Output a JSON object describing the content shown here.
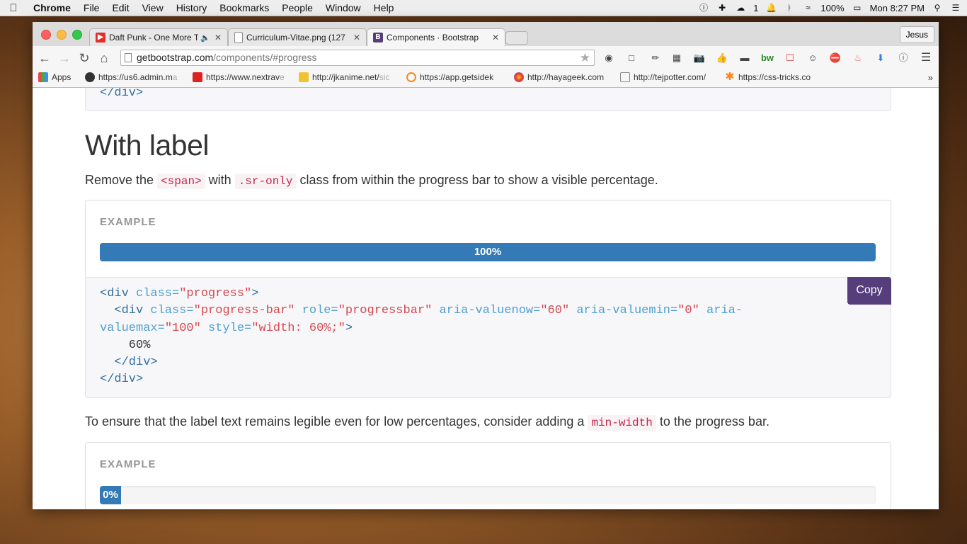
{
  "menubar": {
    "app": "Chrome",
    "items": [
      "File",
      "Edit",
      "View",
      "History",
      "Bookmarks",
      "People",
      "Window",
      "Help"
    ],
    "wifi_count": "1",
    "battery": "100%",
    "clock": "Mon 8:27 PM"
  },
  "tabs": [
    {
      "title": "Daft Punk - One More T",
      "favicon": "youtube-icon",
      "color": "#e52d27"
    },
    {
      "title": "Curriculum-Vitae.png (127",
      "favicon": "file-icon",
      "color": "#ffffff"
    },
    {
      "title": "Components · Bootstrap",
      "favicon": "bootstrap-icon",
      "color": "#563d7c"
    }
  ],
  "profile": "Jesus",
  "url": {
    "host": "getbootstrap.com",
    "path": "/components/#progress"
  },
  "bookmarks": {
    "apps_label": "Apps",
    "items": [
      {
        "label": "https://us6.admin.m",
        "fade": "a"
      },
      {
        "label": "https://www.nextrav",
        "fade": "e"
      },
      {
        "label": "http://jkanime.net/",
        "fade": "sic"
      },
      {
        "label": "https://app.getsidek",
        "fade": ""
      },
      {
        "label": "http://hayageek.com",
        "fade": ""
      },
      {
        "label": "http://tejpotter.com/",
        "fade": ""
      },
      {
        "label": "https://css-tricks.co",
        "fade": ""
      }
    ],
    "more": "»"
  },
  "content": {
    "top_code_line": "</div>",
    "heading": "With label",
    "intro_before": "Remove the ",
    "intro_code1": "<span>",
    "intro_mid": " with ",
    "intro_code2": ".sr-only",
    "intro_after": " class from within the progress bar to show a visible percentage.",
    "example_label": "EXAMPLE",
    "progress1": {
      "label": "100%",
      "value_percent": 100
    },
    "copy_label": "Copy",
    "code_lines": {
      "l1_tag_open": "<div",
      "l1_attr": " class=",
      "l1_val": "\"progress\"",
      "l1_close": ">",
      "l2_tag": "  <div",
      "l2_attr1": " class=",
      "l2_val1": "\"progress-bar\"",
      "l2_attr2": " role=",
      "l2_val2": "\"progressbar\"",
      "l2_attr3": " aria-valuenow=",
      "l2_val3": "\"60\"",
      "l2_attr4": " aria-valuemin=",
      "l2_val4": "\"0\"",
      "l2_attr5": " aria-",
      "l3_attr5b": "valuemax=",
      "l3_val5": "\"100\"",
      "l3_attr6": " style=",
      "l3_val6": "\"width: 60%;\"",
      "l3_close": ">",
      "l4_text": "    60%",
      "l5_close": "  </div>",
      "l6_close": "</div>"
    },
    "legible_before": "To ensure that the label text remains legible even for low percentages, consider adding a ",
    "legible_code": "min-width",
    "legible_after": " to the progress bar.",
    "example_label2": "EXAMPLE",
    "progress2": {
      "label": "0%",
      "value_percent": 0
    }
  }
}
